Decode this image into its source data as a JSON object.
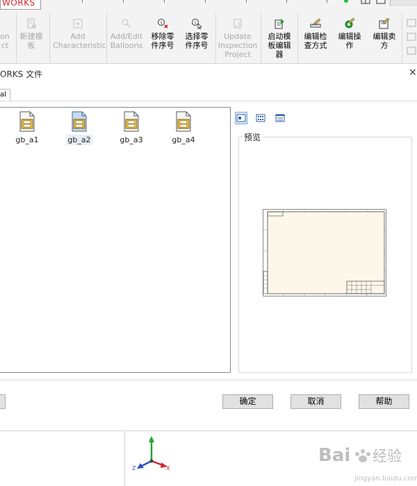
{
  "app": {
    "brand": "WORKS"
  },
  "ribbon": {
    "buttons": [
      {
        "id": "cut1",
        "label": "on\nct",
        "disabled": true
      },
      {
        "id": "new_template",
        "label": "新建模\n板",
        "disabled": true
      },
      {
        "id": "add_char",
        "label": "Add\nCharacteristic",
        "disabled": true
      },
      {
        "id": "add_balloons",
        "label": "Add/Edit\nBalloons",
        "disabled": true
      },
      {
        "id": "remove_part",
        "label": "移除零\n件序号",
        "disabled": false
      },
      {
        "id": "select_part",
        "label": "选择零\n件序号",
        "disabled": false
      },
      {
        "id": "update_project",
        "label": "Update\nInspection\nProject",
        "disabled": true
      },
      {
        "id": "launch_editor",
        "label": "启动模\n板编辑\n器",
        "disabled": false
      },
      {
        "id": "edit_method",
        "label": "编辑检\n查方式",
        "disabled": false
      },
      {
        "id": "edit_op",
        "label": "编辑操\n作",
        "disabled": false
      },
      {
        "id": "edit_vendor",
        "label": "编辑卖\n方",
        "disabled": false
      }
    ]
  },
  "dialog": {
    "title": "ORKS 文件",
    "tab": "al",
    "files": [
      {
        "name": "gb_a1",
        "selected": false
      },
      {
        "name": "gb_a2",
        "selected": true
      },
      {
        "name": "gb_a3",
        "selected": false
      },
      {
        "name": "gb_a4",
        "selected": false
      }
    ],
    "preview_label": "预览",
    "ok": "确定",
    "cancel": "取消",
    "help": "帮助"
  },
  "axes": {
    "y": "Y",
    "x": "X",
    "z": "Z"
  },
  "watermark": {
    "line1": "Bai",
    "line2": "经验",
    "line3": "jingyan.baidu.com"
  },
  "colors": {
    "brand": "#d4262b",
    "y_axis": "#22a036",
    "x_axis": "#d5252f",
    "z_axis": "#2b50c8"
  }
}
